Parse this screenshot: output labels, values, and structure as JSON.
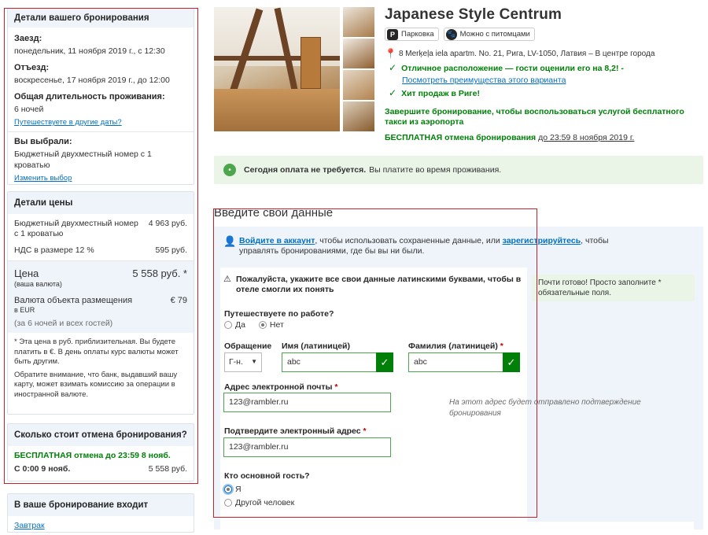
{
  "sidebar": {
    "booking": {
      "title": "Детали вашего бронирования",
      "checkin_label": "Заезд:",
      "checkin_value": "понедельник, 11 ноября 2019 г., с 12:30",
      "checkout_label": "Отъезд:",
      "checkout_value": "воскресенье, 17 ноября 2019 г., до 12:00",
      "duration_label": "Общая длительность проживания:",
      "duration_value": "6 ночей",
      "other_dates_link": "Путешествуете в другие даты?",
      "chosen_label": "Вы выбрали:",
      "chosen_value": "Бюджетный двухместный номер с 1 кроватью",
      "change_link": "Изменить выбор"
    },
    "price": {
      "title": "Детали цены",
      "room_name": "Бюджетный двухместный номер с 1 кроватью",
      "room_price": "4 963 руб.",
      "vat_label": "НДС в размере 12 %",
      "vat_value": "595 руб.",
      "total_label": "Цена",
      "total_sub": "(ваша валюта)",
      "total_value": "5 558 руб. *",
      "currency_label": "Валюта объекта размещения",
      "currency_sub": "в EUR",
      "currency_value": "€ 79",
      "guests_note": "(за 6 ночей и всех гостей)",
      "note1": "*  Эта цена в руб. приблизительная. Вы будете платить в €. В день оплаты курс валюты может быть другим.",
      "note2": "Обратите внимание, что банк, выдавший вашу карту, может взимать комиссию за операции в иностранной валюте."
    },
    "cancel": {
      "title": "Сколько стоит отмена бронирования?",
      "free_text": "БЕСПЛАТНАЯ отмена до 23:59 8 нояб.",
      "from_label": "С 0:00 9 нояб.",
      "from_value": "5 558 руб."
    },
    "includes": {
      "title": "В ваше бронирование входит",
      "item1": "Завтрак"
    }
  },
  "hotel": {
    "name": "Japanese Style Centrum",
    "amenity1": "Парковка",
    "amenity2": "Можно с питомцами",
    "address": "8 Merķeļa iela apartm. No. 21, Рига, LV-1050, Латвия – В центре города",
    "rating_text": "Отличное расположение — гости оценили его на 8,2! -",
    "rating_link": "Посмотреть преимущества этого варианта",
    "hit_text": "Хит продаж в Риге!",
    "taxi_text": "Завершите бронирование, чтобы воспользоваться услугой бесплатного такси из аэропорта",
    "free_cancel_bold": "БЕСПЛАТНАЯ отмена бронирования",
    "free_cancel_link": "до 23:59 8 ноября 2019 г."
  },
  "pay_notice": {
    "bold": "Сегодня оплата не требуется.",
    "rest": "Вы платите во время проживания."
  },
  "form": {
    "heading": "Введите свои данные",
    "login_link": "Войдите в аккаунт",
    "login_mid": ", чтобы использовать сохраненные данные, или",
    "register_link": "зарегистрируйтесь",
    "login_end": ", чтобы управлять бронированиями, где бы вы ни были.",
    "warning": "Пожалуйста, укажите все свои данные латинскими буквами, чтобы в отеле смогли их понять",
    "business_label": "Путешествуете по работе?",
    "yes": "Да",
    "no": "Нет",
    "salutation_label": "Обращение",
    "salutation_value": "Г-н.",
    "first_name_label": "Имя (латиницей)",
    "first_name_value": "abc",
    "last_name_label": "Фамилия (латиницей)",
    "last_name_value": "abc",
    "email_label": "Адрес электронной почты",
    "email_value": "123@rambler.ru",
    "email_hint": "На этот адрес будет отправлено подтверждение бронирования",
    "confirm_label": "Подтвердите электронный адрес",
    "confirm_value": "123@rambler.ru",
    "guest_label": "Кто основной гость?",
    "guest_me": "Я",
    "guest_other": "Другой человек",
    "ready_hint": "Почти готово! Просто заполните * обязательные поля."
  },
  "colors": {
    "accent": "#0071c2",
    "green": "#008009",
    "highlight": "#c6222a",
    "panel": "#eef4fa"
  }
}
